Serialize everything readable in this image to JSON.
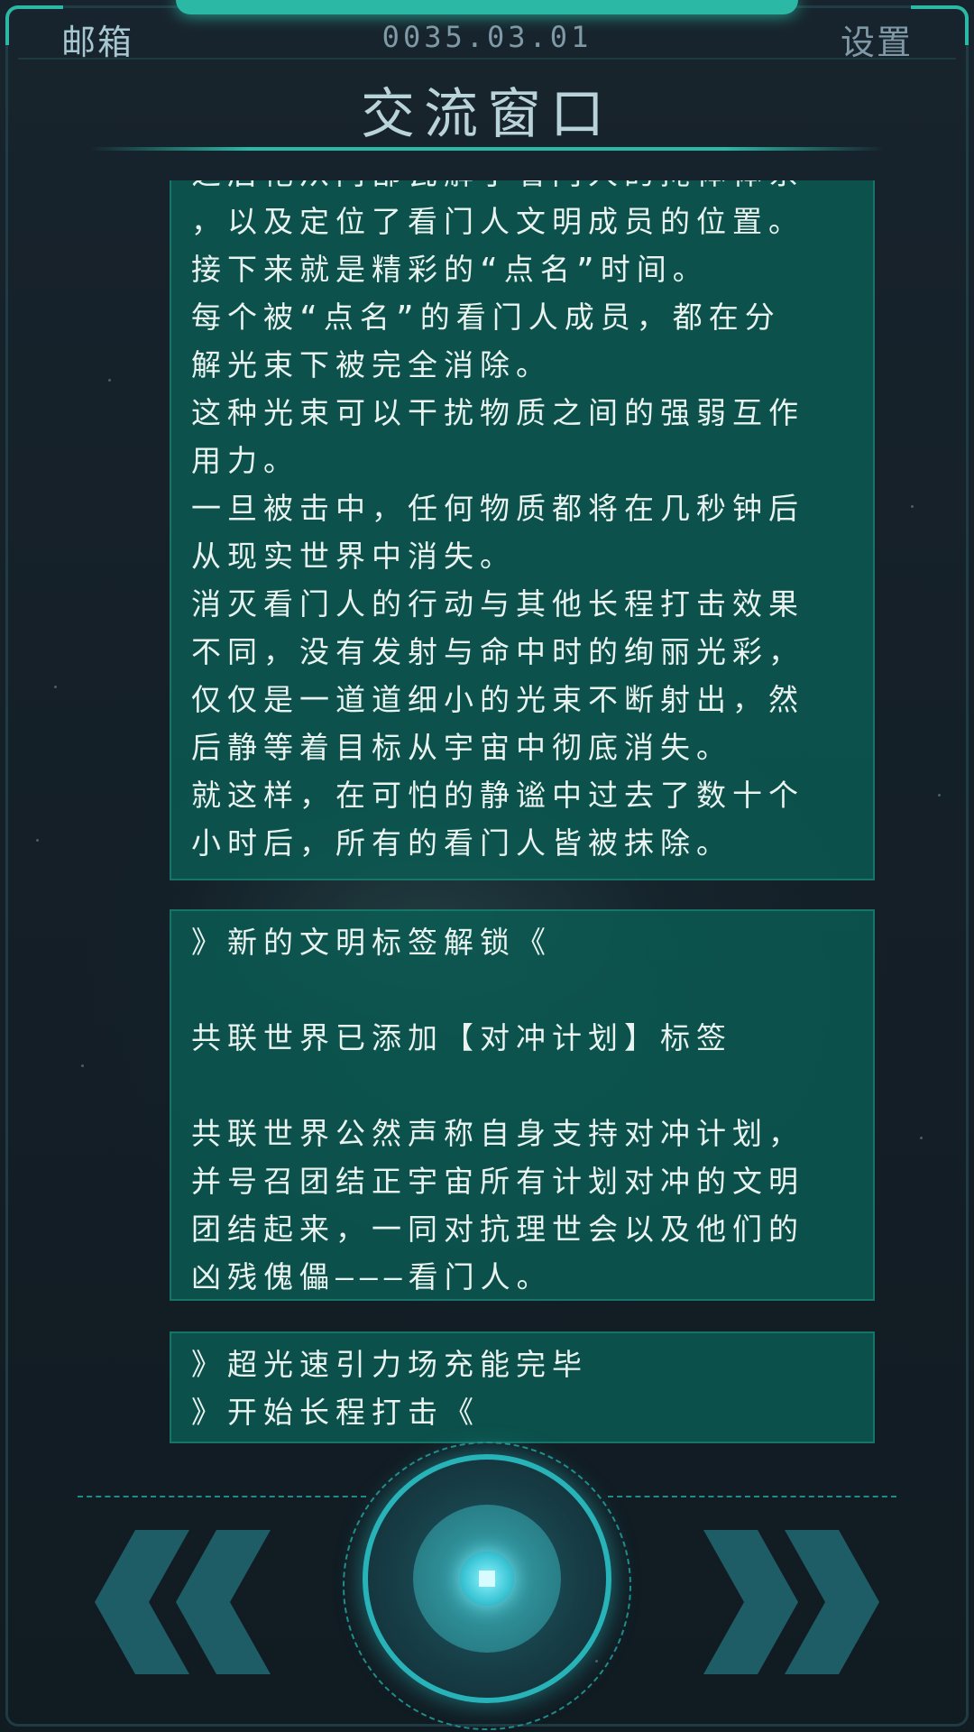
{
  "header": {
    "mail_label": "邮箱",
    "date": "0035.03.01",
    "settings_label": "设置",
    "title": "交流窗口"
  },
  "messages": {
    "card1": [
      "之后祂从内部瓦解了看门人的掩体体系",
      "，以及定位了看门人文明成员的位置。",
      "接下来就是精彩的“点名”时间。",
      "每个被“点名”的看门人成员，都在分",
      "解光束下被完全消除。",
      "这种光束可以干扰物质之间的强弱互作",
      "用力。",
      "一旦被击中，任何物质都将在几秒钟后",
      "从现实世界中消失。",
      "消灭看门人的行动与其他长程打击效果",
      "不同，没有发射与命中时的绚丽光彩，",
      "仅仅是一道道细小的光束不断射出，然",
      "后静等着目标从宇宙中彻底消失。",
      "就这样，在可怕的静谧中过去了数十个",
      "小时后，所有的看门人皆被抹除。"
    ],
    "card2": [
      "》新的文明标签解锁《",
      "",
      "共联世界已添加【对冲计划】标签",
      "",
      "共联世界公然声称自身支持对冲计划，",
      "并号召团结正宇宙所有计划对冲的文明",
      "团结起来，一同对抗理世会以及他们的",
      "凶残傀儡———看门人。"
    ],
    "card3": [
      "》超光速引力场充能完毕",
      "》开始长程打击《"
    ]
  },
  "colors": {
    "accent": "#2bb9a6",
    "card_bg": "#0a5f56",
    "background": "#142029",
    "title_text": "#b9d3db",
    "chevron": "#1f5d66"
  },
  "controls": {
    "prev_icon": "double-chevron-left-icon",
    "next_icon": "double-chevron-right-icon",
    "center_icon": "stop-icon"
  }
}
